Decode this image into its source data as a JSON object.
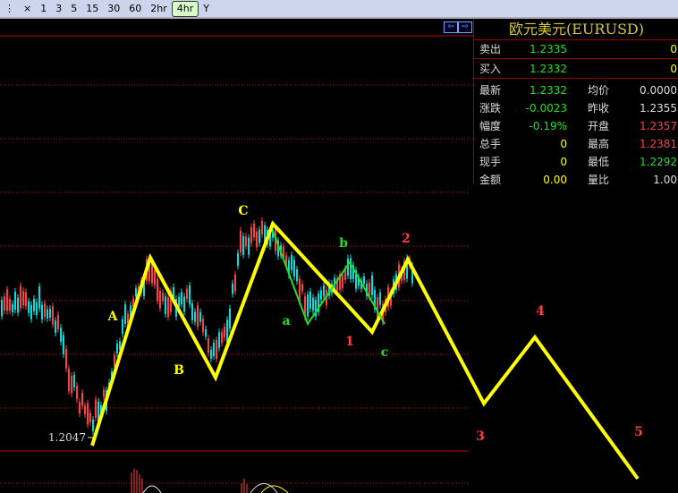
{
  "toolbar": {
    "items": [
      "×",
      "1",
      "3",
      "5",
      "15",
      "30",
      "60",
      "2hr",
      "4hr",
      "Y"
    ],
    "active": "4hr"
  },
  "quote": {
    "title": "欧元美元(EURUSD)",
    "sell": {
      "label": "卖出",
      "price": "1.2335",
      "vol": "0"
    },
    "buy": {
      "label": "买入",
      "price": "1.2332",
      "vol": "0"
    },
    "rows": [
      {
        "l1": "最新",
        "v1": "1.2332",
        "l2": "均价",
        "v2": "0.0000"
      },
      {
        "l1": "涨跌",
        "v1": "-0.0023",
        "l2": "昨收",
        "v2": "1.2355"
      },
      {
        "l1": "幅度",
        "v1": "-0.19%",
        "l2": "开盘",
        "v2": "1.2357"
      },
      {
        "l1": "总手",
        "v1": "0",
        "l2": "最高",
        "v2": "1.2381"
      },
      {
        "l1": "现手",
        "v1": "0",
        "l2": "最低",
        "v2": "1.2292"
      },
      {
        "l1": "金额",
        "v1": "0.00",
        "l2": "量比",
        "v2": "1.00"
      }
    ]
  },
  "chart": {
    "low_label": "1.2047",
    "wave_labels": {
      "A": "A",
      "B": "B",
      "C": "C",
      "a": "a",
      "b": "b",
      "c": "c",
      "w1": "1",
      "w2": "2",
      "w3": "3",
      "w4": "4",
      "w5": "5"
    },
    "colors": {
      "up": "#ff4040",
      "down": "#00e0e0",
      "wave": "#ffff00",
      "sub_wave": "#22e022",
      "grid": "#c00000"
    }
  }
}
